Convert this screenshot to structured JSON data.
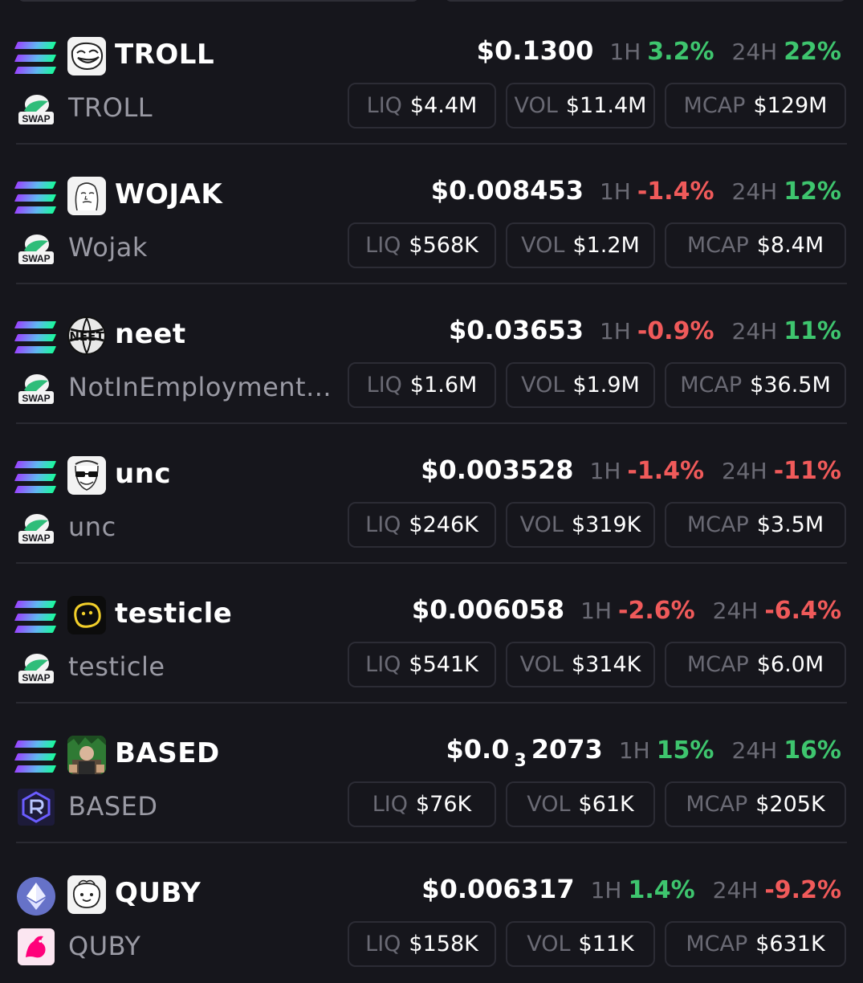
{
  "tokens": [
    {
      "symbol": "TROLL",
      "name": "TROLL",
      "chain_icon": "solana-icon",
      "dex_icon": "swap-icon",
      "avatar_icon": "trollface-icon",
      "price": "$0.1300",
      "h1_label": "1H",
      "h1": "3.2%",
      "h1_dir": "pos",
      "h24_label": "24H",
      "h24": "22%",
      "h24_dir": "pos",
      "liq_label": "LIQ",
      "liq": "$4.4M",
      "vol_label": "VOL",
      "vol": "$11.4M",
      "mcap_label": "MCAP",
      "mcap": "$129M"
    },
    {
      "symbol": "WOJAK",
      "name": "Wojak",
      "chain_icon": "solana-icon",
      "dex_icon": "swap-icon",
      "avatar_icon": "wojak-face-icon",
      "price": "$0.008453",
      "h1_label": "1H",
      "h1": "-1.4%",
      "h1_dir": "neg",
      "h24_label": "24H",
      "h24": "12%",
      "h24_dir": "pos",
      "liq_label": "LIQ",
      "liq": "$568K",
      "vol_label": "VOL",
      "vol": "$1.2M",
      "mcap_label": "MCAP",
      "mcap": "$8.4M"
    },
    {
      "symbol": "neet",
      "name": "NotInEmployment...",
      "chain_icon": "solana-icon",
      "dex_icon": "swap-icon",
      "avatar_icon": "neet-globe-icon",
      "price": "$0.03653",
      "h1_label": "1H",
      "h1": "-0.9%",
      "h1_dir": "neg",
      "h24_label": "24H",
      "h24": "11%",
      "h24_dir": "pos",
      "liq_label": "LIQ",
      "liq": "$1.6M",
      "vol_label": "VOL",
      "vol": "$1.9M",
      "mcap_label": "MCAP",
      "mcap": "$36.5M"
    },
    {
      "symbol": "unc",
      "name": "unc",
      "chain_icon": "solana-icon",
      "dex_icon": "swap-icon",
      "avatar_icon": "unc-sunglasses-icon",
      "price": "$0.003528",
      "h1_label": "1H",
      "h1": "-1.4%",
      "h1_dir": "neg",
      "h24_label": "24H",
      "h24": "-11%",
      "h24_dir": "neg",
      "liq_label": "LIQ",
      "liq": "$246K",
      "vol_label": "VOL",
      "vol": "$319K",
      "mcap_label": "MCAP",
      "mcap": "$3.5M"
    },
    {
      "symbol": "testicle",
      "name": "testicle",
      "chain_icon": "solana-icon",
      "dex_icon": "swap-icon",
      "avatar_icon": "testicle-blob-icon",
      "price": "$0.006058",
      "h1_label": "1H",
      "h1": "-2.6%",
      "h1_dir": "neg",
      "h24_label": "24H",
      "h24": "-6.4%",
      "h24_dir": "neg",
      "liq_label": "LIQ",
      "liq": "$541K",
      "vol_label": "VOL",
      "vol": "$314K",
      "mcap_label": "MCAP",
      "mcap": "$6.0M"
    },
    {
      "symbol": "BASED",
      "name": "BASED",
      "chain_icon": "solana-icon",
      "dex_icon": "raydium-icon",
      "avatar_icon": "based-photo-icon",
      "price_prefix": "$0.0",
      "price_sub": "3",
      "price_suffix": "2073",
      "h1_label": "1H",
      "h1": "15%",
      "h1_dir": "pos",
      "h24_label": "24H",
      "h24": "16%",
      "h24_dir": "pos",
      "liq_label": "LIQ",
      "liq": "$76K",
      "vol_label": "VOL",
      "vol": "$61K",
      "mcap_label": "MCAP",
      "mcap": "$205K"
    },
    {
      "symbol": "QUBY",
      "name": "QUBY",
      "chain_icon": "ethereum-icon",
      "dex_icon": "uniswap-icon",
      "avatar_icon": "quby-face-icon",
      "price": "$0.006317",
      "h1_label": "1H",
      "h1": "1.4%",
      "h1_dir": "pos",
      "h24_label": "24H",
      "h24": "-9.2%",
      "h24_dir": "neg",
      "liq_label": "LIQ",
      "liq": "$158K",
      "vol_label": "VOL",
      "vol": "$11K",
      "mcap_label": "MCAP",
      "mcap": "$631K"
    }
  ],
  "colors": {
    "background": "#16161c",
    "positive": "#3ec56e",
    "negative": "#f05a5a",
    "muted": "#6a6a74",
    "border": "#2c2c35"
  }
}
